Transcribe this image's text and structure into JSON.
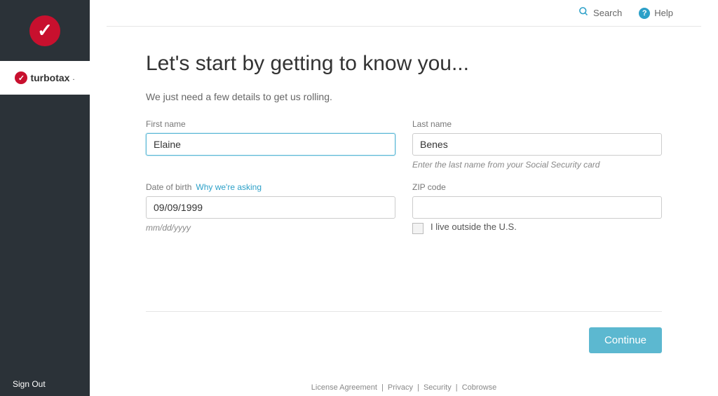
{
  "sidebar": {
    "brand": "turbotax",
    "sign_out": "Sign Out"
  },
  "header": {
    "search": "Search",
    "help": "Help"
  },
  "page": {
    "heading": "Let's start by getting to know you...",
    "subtext": "We just need a few details to get us rolling."
  },
  "form": {
    "first_name": {
      "label": "First name",
      "value": "Elaine"
    },
    "last_name": {
      "label": "Last name",
      "value": "Benes",
      "helper": "Enter the last name from your Social Security card"
    },
    "dob": {
      "label": "Date of birth",
      "link": "Why we're asking",
      "value": "09/09/1999",
      "helper": "mm/dd/yyyy"
    },
    "zip": {
      "label": "ZIP code",
      "value": ""
    },
    "outside_us": {
      "label": "I live outside the U.S."
    }
  },
  "buttons": {
    "continue": "Continue"
  },
  "footer": {
    "license": "License Agreement",
    "privacy": "Privacy",
    "security": "Security",
    "cobrowse": "Cobrowse"
  }
}
